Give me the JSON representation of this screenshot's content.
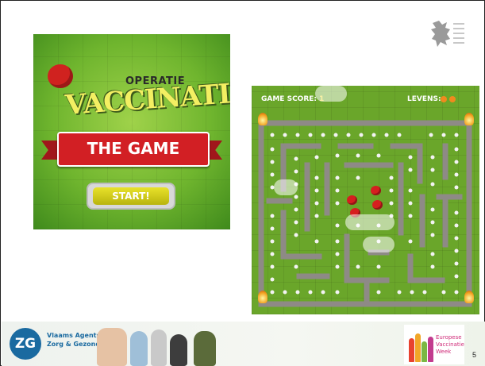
{
  "title_screen": {
    "subtitle": "OPERATIE",
    "title": "VACCINATIE",
    "banner": "THE GAME",
    "start_button": "START!"
  },
  "game": {
    "score_label": "GAME SCORE:",
    "score_value": "1",
    "lives_label": "LEVENS:",
    "lives_count": 2
  },
  "footer": {
    "logo_letters": "ZG",
    "org_line1": "Vlaams Agentschap",
    "org_line2": "Zorg & Gezondheid",
    "evw_line1": "Europese",
    "evw_line2": "Vaccinatie",
    "evw_line3": "Week"
  },
  "page_number": "5",
  "colors": {
    "grass": "#6aa62a",
    "maze_wall": "#8e8a86",
    "virus_red": "#d61f1f",
    "banner_red": "#d21f24",
    "zg_blue": "#1a6aa0"
  },
  "icons": {
    "top_right_logo": "flemish-lion-logo"
  }
}
